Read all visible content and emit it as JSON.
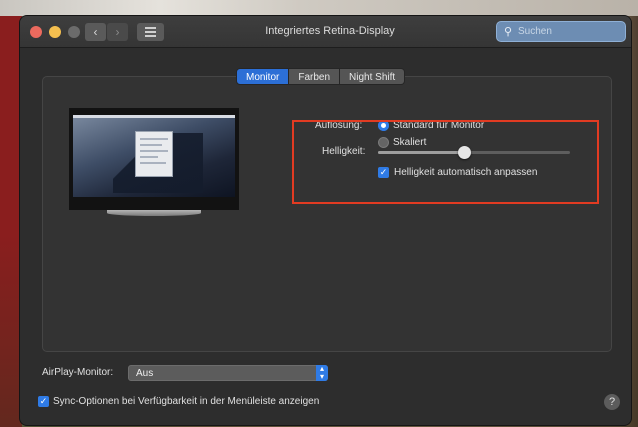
{
  "window": {
    "title": "Integriertes Retina-Display",
    "search_placeholder": "Suchen",
    "back_glyph": "‹",
    "forward_glyph": "›"
  },
  "tabs": [
    {
      "label": "Monitor",
      "active": true
    },
    {
      "label": "Farben",
      "active": false
    },
    {
      "label": "Night Shift",
      "active": false
    }
  ],
  "resolution": {
    "label": "Auflösung:",
    "options": [
      {
        "label": "Standard für Monitor",
        "selected": true
      },
      {
        "label": "Skaliert",
        "selected": false
      }
    ]
  },
  "brightness": {
    "label": "Helligkeit:",
    "level": 0.45,
    "auto_label": "Helligkeit automatisch anpassen",
    "auto_checked": true
  },
  "airplay": {
    "label": "AirPlay-Monitor:",
    "value": "Aus"
  },
  "sync": {
    "label": "Sync-Optionen bei Verfügbarkeit in der Menüleiste anzeigen",
    "checked": true
  },
  "help_glyph": "?",
  "colors": {
    "accent": "#2f7be6",
    "highlight": "#e23b22",
    "window_bg": "#2d2d2d"
  },
  "icons": {
    "search": "search-icon",
    "check": "✓"
  }
}
